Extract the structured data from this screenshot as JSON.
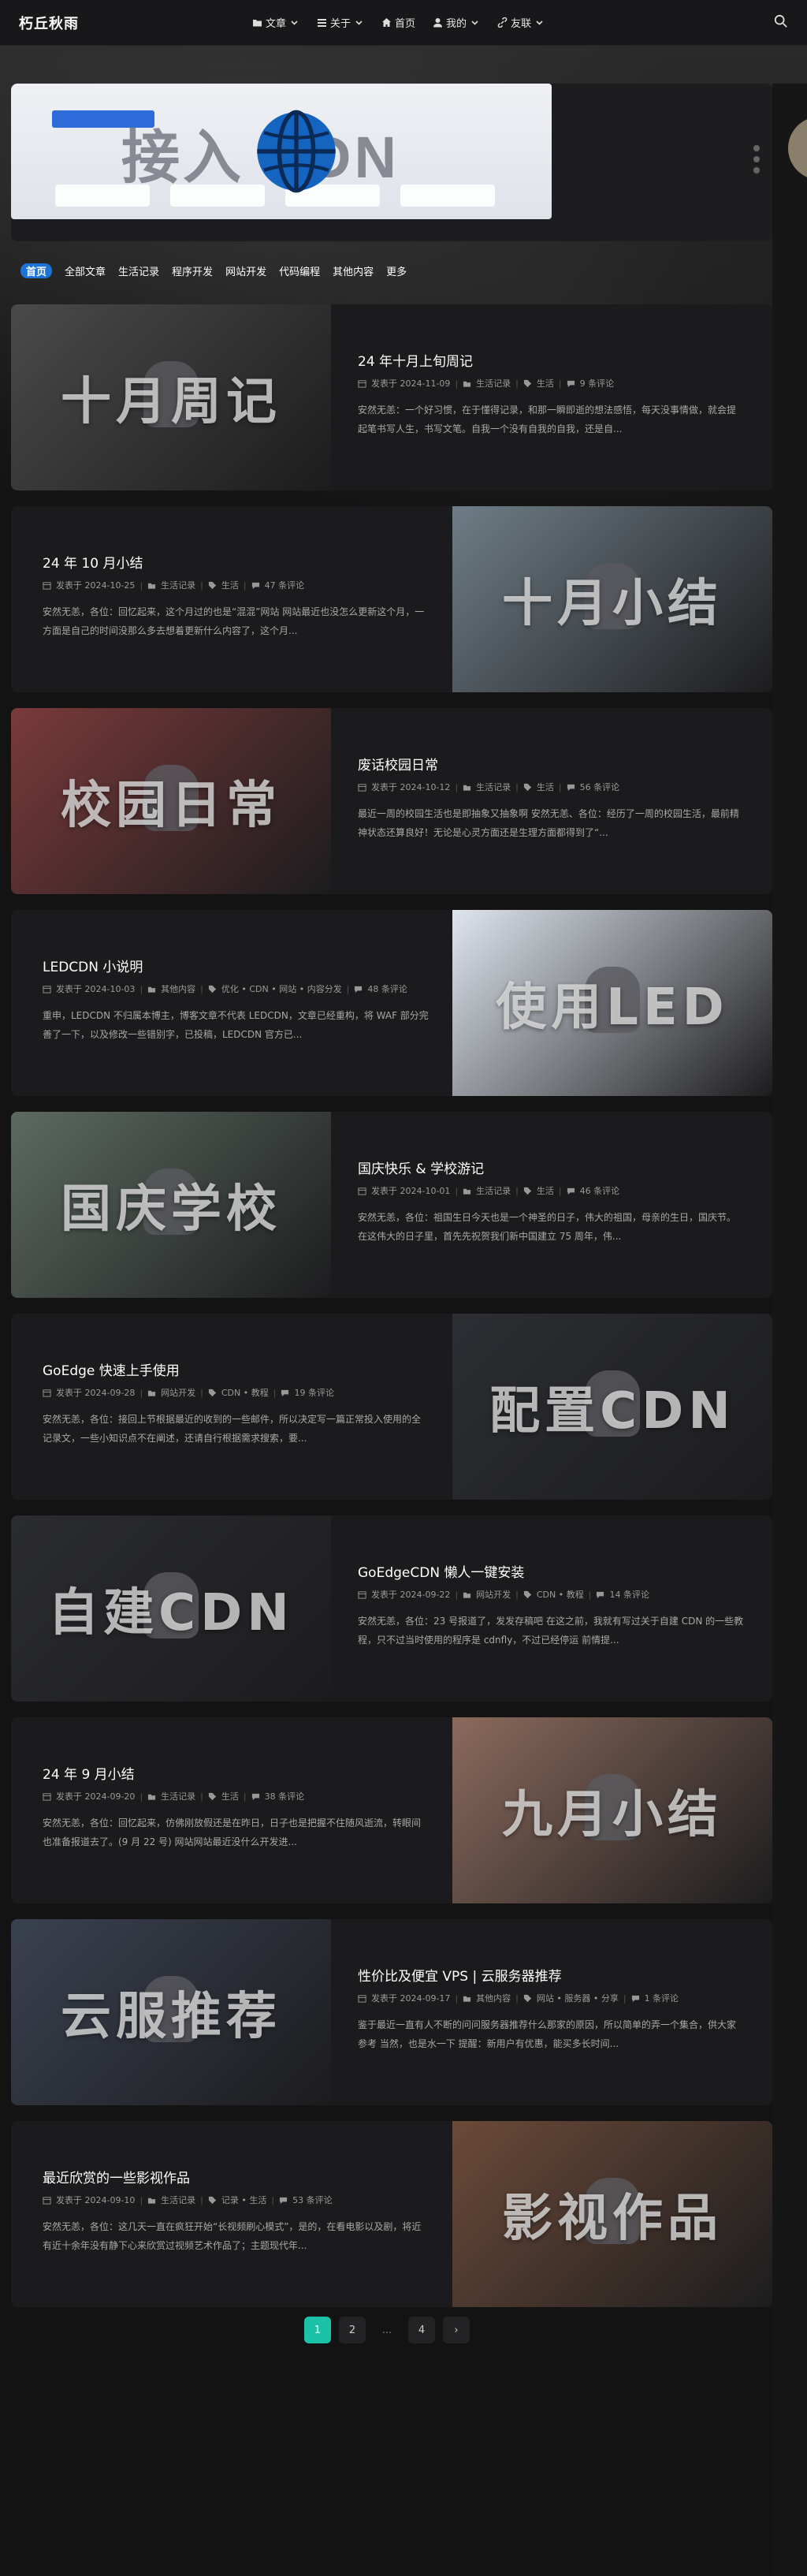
{
  "site": {
    "logo": "朽丘秋雨"
  },
  "nav": [
    {
      "label": "文章",
      "icon": "folder-icon",
      "has_dropdown": true
    },
    {
      "label": "关于",
      "icon": "list-icon",
      "has_dropdown": true
    },
    {
      "label": "首页",
      "icon": "home-icon",
      "has_dropdown": false
    },
    {
      "label": "我的",
      "icon": "user-icon",
      "has_dropdown": true
    },
    {
      "label": "友联",
      "icon": "link-icon",
      "has_dropdown": true
    }
  ],
  "banner": {
    "title": "接入 CDN"
  },
  "tabs": [
    {
      "label": "首页",
      "active": true
    },
    {
      "label": "全部文章",
      "active": false
    },
    {
      "label": "生活记录",
      "active": false
    },
    {
      "label": "程序开发",
      "active": false
    },
    {
      "label": "网站开发",
      "active": false
    },
    {
      "label": "代码编程",
      "active": false
    },
    {
      "label": "其他内容",
      "active": false
    },
    {
      "label": "更多",
      "active": false
    }
  ],
  "posts": [
    {
      "title": "24 年十月上旬周记",
      "date": "发表于 2024-11-09",
      "category": "生活记录",
      "tags": "生活",
      "comments": "9 条评论",
      "excerpt": "安然无恙：一个好习惯，在于懂得记录，和那一瞬即逝的想法感悟，每天没事情做，就会提起笔书写人生，书写文笔。自我一个没有自我的自我，还是自...",
      "thumb_text": "十月周记",
      "thumb_color": "#4a4a4a",
      "thumb_side": "left"
    },
    {
      "title": "24 年 10 月小结",
      "date": "发表于 2024-10-25",
      "category": "生活记录",
      "tags": "生活",
      "comments": "47 条评论",
      "excerpt": "安然无恙，各位：回忆起来，这个月过的也是“混混”网站 网站最近也没怎么更新这个月，一方面是自己的时间没那么多去想着更新什么内容了，这个月...",
      "thumb_text": "十月小结",
      "thumb_color": "#6f7d86",
      "thumb_side": "right"
    },
    {
      "title": "废话校园日常",
      "date": "发表于 2024-10-12",
      "category": "生活记录",
      "tags": "生活",
      "comments": "56 条评论",
      "excerpt": "最近一周的校园生活也是即抽象又抽象啊 安然无恙、各位：经历了一周的校园生活，最前精神状态还算良好！无论是心灵方面还是生理方面都得到了“...",
      "thumb_text": "校园日常",
      "thumb_color": "#7a3a3a",
      "thumb_side": "left"
    },
    {
      "title": "LEDCDN 小说明",
      "date": "发表于 2024-10-03",
      "category": "其他内容",
      "tags": "优化 • CDN • 网站 • 内容分发",
      "comments": "48 条评论",
      "excerpt": "重申，LEDCDN 不归属本博主，博客文章不代表 LEDCDN，文章已经重构，将 WAF 部分完善了一下，以及修改一些错别字，已投稿，LEDCDN 官方已...",
      "thumb_text": "使用LED",
      "thumb_color": "#dfe5ee",
      "thumb_side": "right"
    },
    {
      "title": "国庆快乐 & 学校游记",
      "date": "发表于 2024-10-01",
      "category": "生活记录",
      "tags": "生活",
      "comments": "46 条评论",
      "excerpt": "安然无恙，各位：祖国生日今天也是一个神圣的日子，伟大的祖国，母亲的生日，国庆节。在这伟大的日子里，首先先祝贺我们新中国建立 75 周年，伟...",
      "thumb_text": "国庆学校",
      "thumb_color": "#5c6a60",
      "thumb_side": "left"
    },
    {
      "title": "GoEdge 快速上手使用",
      "date": "发表于 2024-09-28",
      "category": "网站开发",
      "tags": "CDN • 教程",
      "comments": "19 条评论",
      "excerpt": "安然无恙，各位：接回上节根据最近的收到的一些邮件，所以决定写一篇正常投入使用的全记录文，一些小知识点不在阐述，还请自行根据需求搜索，要...",
      "thumb_text": "配置CDN",
      "thumb_color": "#2c2e33",
      "thumb_side": "right"
    },
    {
      "title": "GoEdgeCDN 懒人一键安装",
      "date": "发表于 2024-09-22",
      "category": "网站开发",
      "tags": "CDN • 教程",
      "comments": "14 条评论",
      "excerpt": "安然无恙，各位：23 号报道了，发发存稿吧 在这之前，我就有写过关于自建 CDN 的一些教程，只不过当时使用的程序是 cdnfly，不过已经停运 前情提...",
      "thumb_text": "自建CDN",
      "thumb_color": "#2b2c30",
      "thumb_side": "left"
    },
    {
      "title": "24 年 9 月小结",
      "date": "发表于 2024-09-20",
      "category": "生活记录",
      "tags": "生活",
      "comments": "38 条评论",
      "excerpt": "安然无恙，各位：回忆起来，仿佛刚放假还是在昨日，日子也是把握不住随风逝流，转眼间也准备报道去了。(9 月 22 号) 网站网站最近没什么开发进...",
      "thumb_text": "九月小结",
      "thumb_color": "#8b6a5c",
      "thumb_side": "right"
    },
    {
      "title": "性价比及便宜 VPS | 云服务器推荐",
      "date": "发表于 2024-09-17",
      "category": "其他内容",
      "tags": "网站 • 服务器 • 分享",
      "comments": "1 条评论",
      "excerpt": "鉴于最近一直有人不断的问问服务器推荐什么那家的原因，所以简单的弄一个集合，供大家参考 当然，也是水一下 提醒：新用户有优惠，能买多长时间...",
      "thumb_text": "云服推荐",
      "thumb_color": "#3a4150",
      "thumb_side": "left"
    },
    {
      "title": "最近欣赏的一些影视作品",
      "date": "发表于 2024-09-10",
      "category": "生活记录",
      "tags": "记录 • 生活",
      "comments": "53 条评论",
      "excerpt": "安然无恙，各位：这几天一直在疯狂开始“长视频刷心模式”，是的，在看电影以及剧，将近有近十余年没有静下心来欣赏过视频艺术作品了；主题现代年...",
      "thumb_text": "影视作品",
      "thumb_color": "#6b4a38",
      "thumb_side": "right"
    }
  ],
  "pagination": {
    "current": "1",
    "pages": [
      "1",
      "2",
      "...",
      "4"
    ],
    "next": "›"
  },
  "colors": {
    "accent": "#1cc2a8",
    "tab_active": "#1a74d8"
  }
}
